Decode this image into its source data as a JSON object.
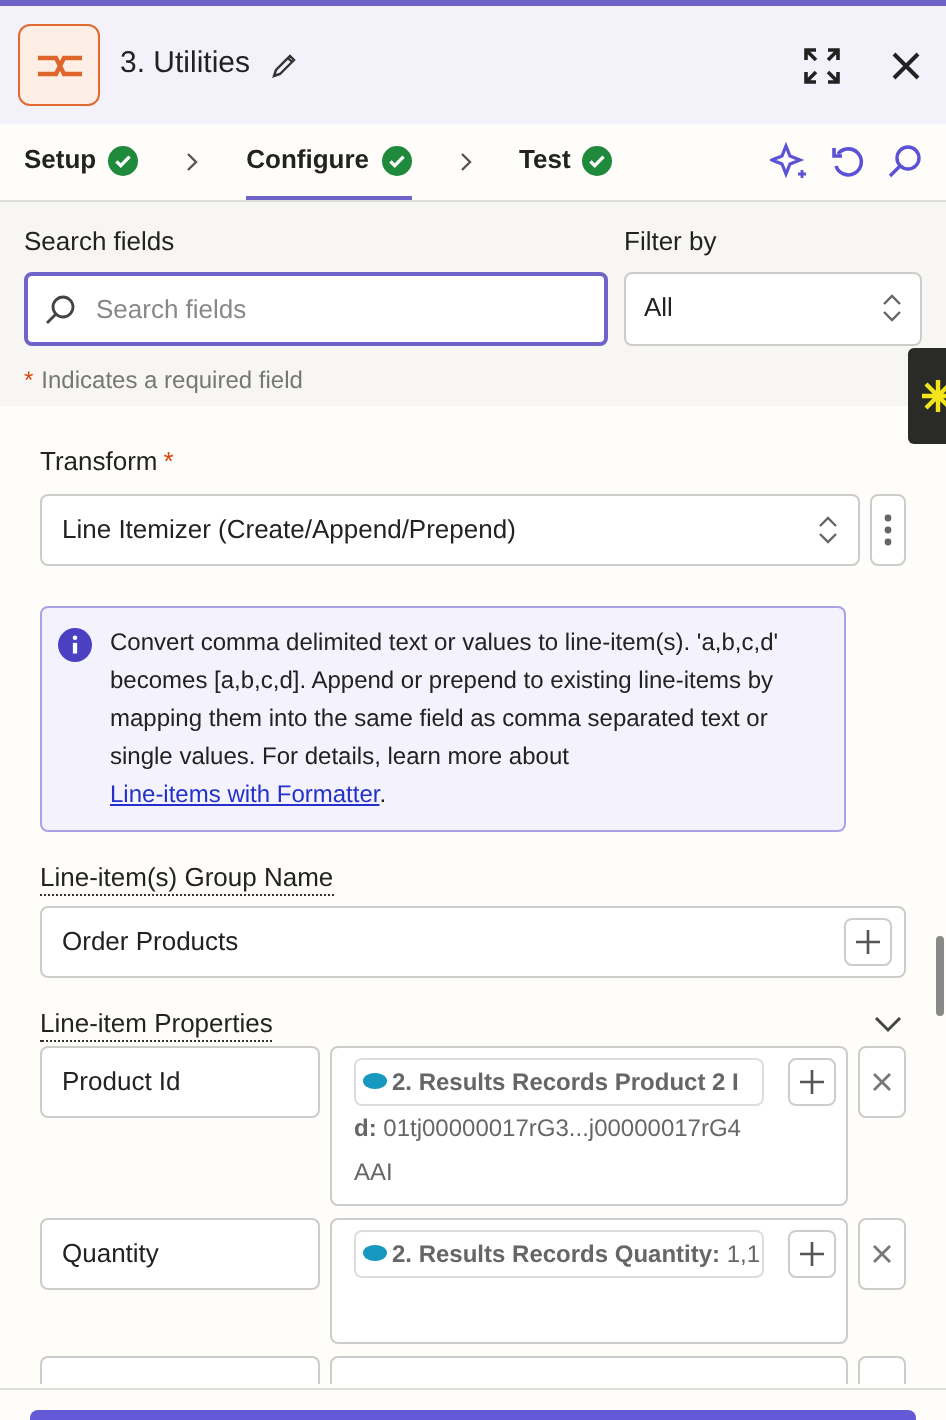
{
  "header": {
    "title": "3. Utilities"
  },
  "steps": [
    {
      "label": "Setup",
      "selected": false,
      "done": true
    },
    {
      "label": "Configure",
      "selected": true,
      "done": true
    },
    {
      "label": "Test",
      "selected": false,
      "done": true
    }
  ],
  "search": {
    "label": "Search fields",
    "placeholder": "Search fields"
  },
  "filter": {
    "label": "Filter by",
    "value": "All"
  },
  "required_note": {
    "mark": "*",
    "text": "Indicates a required field"
  },
  "transform": {
    "label": "Transform",
    "required_mark": "*",
    "value": "Line Itemizer (Create/Append/Prepend)"
  },
  "info": {
    "text": "Convert comma delimited text or values to line-item(s). 'a,b,c,d' becomes [a,b,c,d]. Append or prepend to existing line-items by mapping them into the same field as comma separated text or single values. For details, learn more about ",
    "link": "Line-items with Formatter",
    "after": "."
  },
  "group_name": {
    "label": "Line-item(s) Group Name",
    "value": "Order Products"
  },
  "properties": {
    "label": "Line-item Properties",
    "expanded": true,
    "rows": [
      {
        "key": "Product Id",
        "value_lines": [
          "**2. Results Records Product 2 I**",
          "**d:** 01tj00000017rG3...j00000017rG4",
          "AAI"
        ]
      },
      {
        "key": "Quantity",
        "value_lines": [
          "**2. Results Records Quantity:** 1,1"
        ]
      }
    ]
  }
}
